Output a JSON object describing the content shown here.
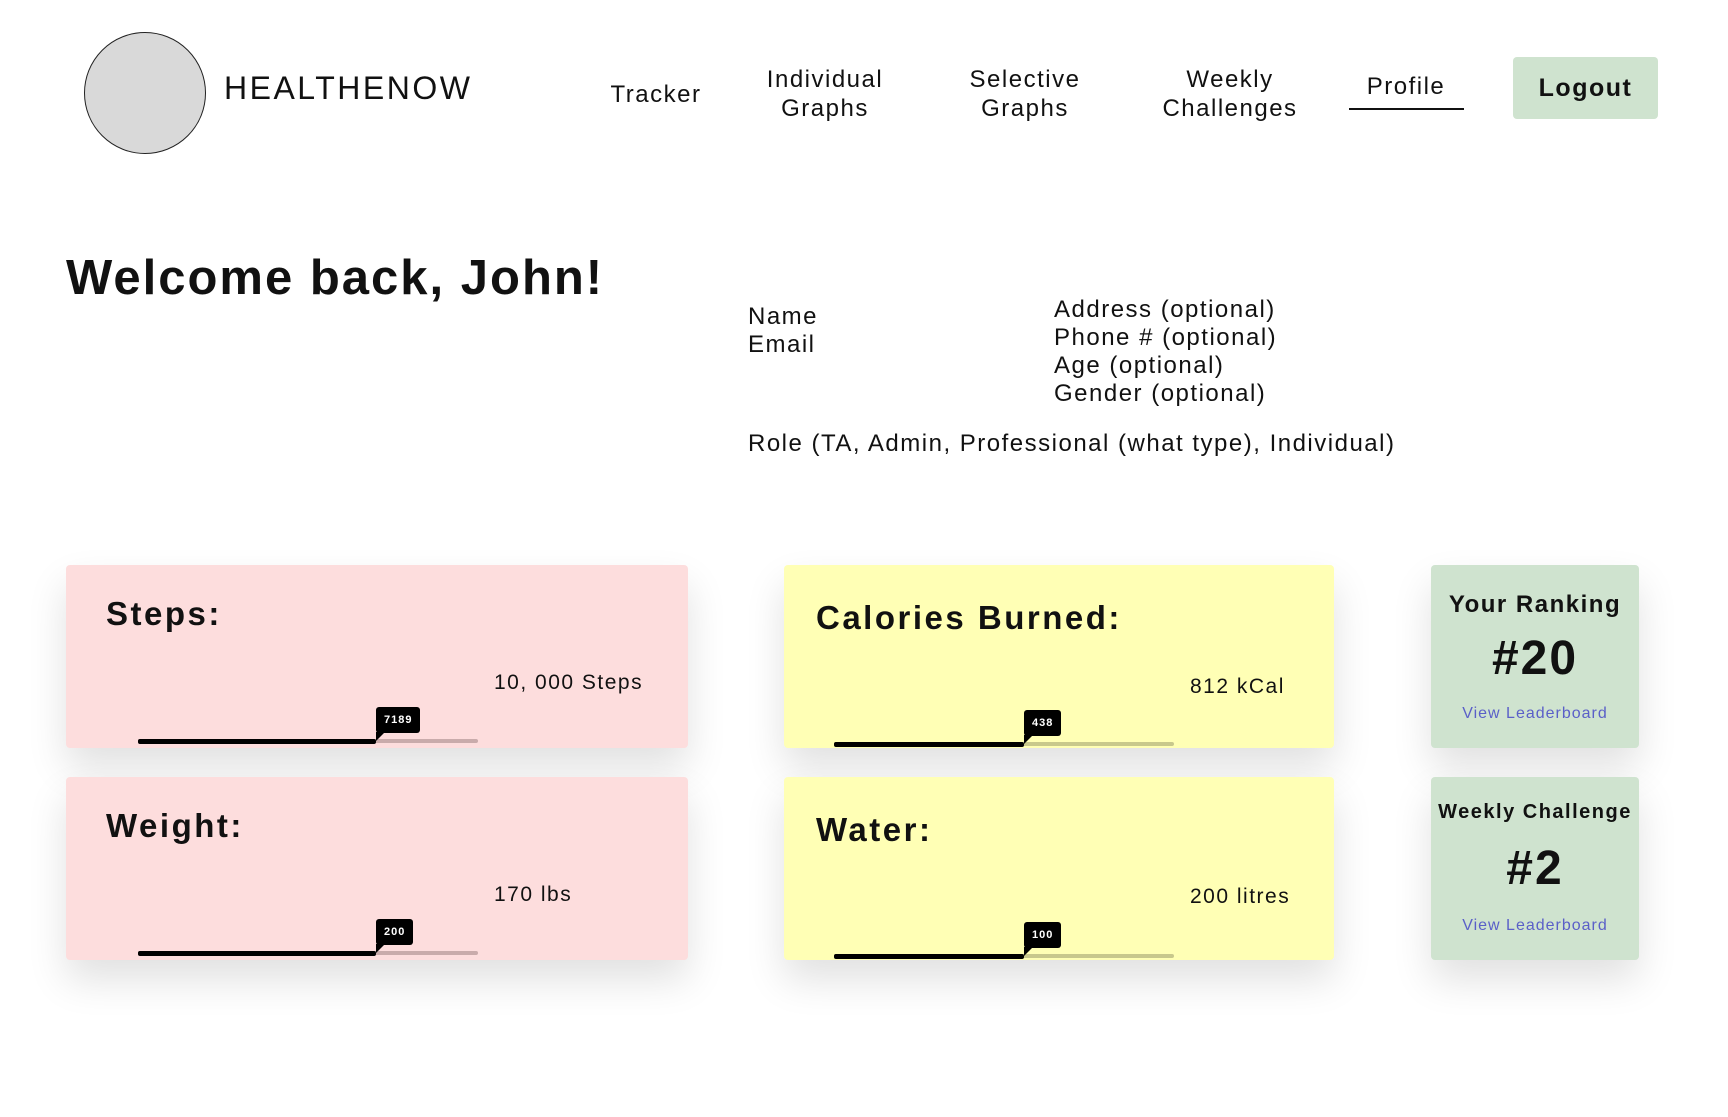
{
  "header": {
    "brand": "HEALTHENOW",
    "nav": {
      "tracker": "Tracker",
      "individual_line1": "Individual",
      "individual_line2": "Graphs",
      "selective_line1": "Selective",
      "selective_line2": "Graphs",
      "weekly_line1": "Weekly",
      "weekly_line2": "Challenges",
      "profile": "Profile"
    },
    "logout": "Logout"
  },
  "welcome": "Welcome back, John!",
  "profile_info": {
    "name": "Name",
    "email": "Email",
    "address": "Address (optional)",
    "phone": "Phone # (optional)",
    "age": "Age (optional)",
    "gender": "Gender (optional)",
    "role": "Role (TA, Admin, Professional (what type), Individual)"
  },
  "metrics": {
    "steps": {
      "title": "Steps:",
      "value": "7189",
      "goal": "10, 000 Steps",
      "fill_fraction": 0.7
    },
    "weight": {
      "title": "Weight:",
      "value": "200",
      "goal": "170 lbs",
      "fill_fraction": 0.7
    },
    "calories": {
      "title": "Calories Burned:",
      "value": "438",
      "goal": "812 kCal",
      "fill_fraction": 0.56
    },
    "water": {
      "title": "Water:",
      "value": "100",
      "goal": "200 litres",
      "fill_fraction": 0.56
    }
  },
  "ranking": {
    "title": "Your Ranking",
    "value": "#20",
    "link": "View Leaderboard"
  },
  "weekly_challenge": {
    "title": "Weekly Challenge",
    "value": "#2",
    "link": "View Leaderboard"
  },
  "colors": {
    "pink_card": "#fddddd",
    "yellow_card": "#ffffb5",
    "green_card": "#cfe3cf",
    "link": "#5a5fc8"
  }
}
